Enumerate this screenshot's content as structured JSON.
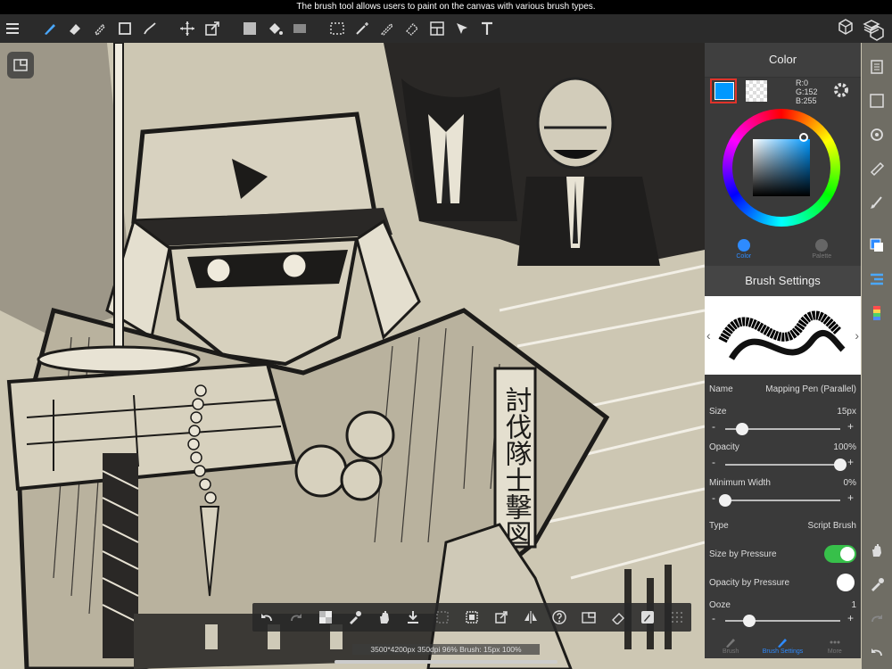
{
  "banner": "The brush tool allows users to paint on the canvas with various brush types.",
  "colors": {
    "primary": "#0098ff",
    "secondary": "#f2f2f2",
    "accent": "#2e8bff",
    "toggle_on": "#37c04a"
  },
  "color_panel": {
    "title": "Color",
    "rgb": {
      "r": "R:0",
      "g": "G:152",
      "b": "B:255"
    },
    "tabs": [
      {
        "label": "Color"
      },
      {
        "label": "Palette"
      }
    ]
  },
  "brush_panel": {
    "title": "Brush Settings",
    "name_label": "Name",
    "name_value": "Mapping Pen (Parallel)",
    "size_label": "Size",
    "size_value": "15px",
    "size_level": 0.15,
    "opacity_label": "Opacity",
    "opacity_value": "100%",
    "opacity_level": 1.0,
    "minwidth_label": "Minimum Width",
    "minwidth_value": "0%",
    "minwidth_level": 0.0,
    "type_label": "Type",
    "type_value": "Script Brush",
    "sizebypressure_label": "Size by Pressure",
    "opacitybypressure_label": "Opacity by Pressure",
    "ooze_label": "Ooze",
    "ooze_value": "1",
    "slider_minus": "-",
    "slider_plus": "+",
    "tabs": [
      {
        "label": "Brush"
      },
      {
        "label": "Brush Settings"
      },
      {
        "label": "More"
      }
    ]
  },
  "status": "3500*4200px 350dpi 96% Brush: 15px 100%",
  "canvas_text": "討伐隊士擊図"
}
